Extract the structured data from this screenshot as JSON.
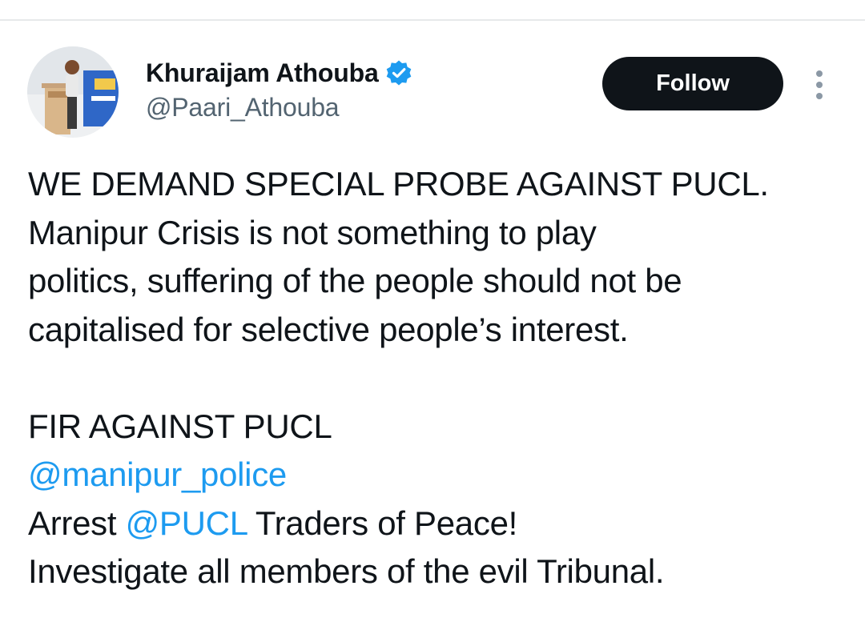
{
  "author": {
    "display_name": "Khuraijam Athouba",
    "handle": "@Paari_Athouba",
    "verified": true,
    "avatar_icon": "profile-photo"
  },
  "actions": {
    "follow_label": "Follow",
    "more_icon": "more-vertical-icon"
  },
  "tweet": {
    "line1": "WE DEMAND SPECIAL PROBE AGAINST PUCL.",
    "line2": "Manipur Crisis is not something to play",
    "line3": "politics, suffering of the people should not be",
    "line4": "capitalised for selective people’s interest.",
    "line5": "FIR AGAINST PUCL",
    "mention1": "@manipur_police",
    "line7_prefix": "Arrest ",
    "mention2": "@PUCL",
    "line7_suffix": " Traders of Peace!",
    "line8": "Investigate all members of the evil Tribunal."
  },
  "colors": {
    "text": "#0f1419",
    "secondary": "#536471",
    "link": "#1d9bf0",
    "button_bg": "#0f1419",
    "button_text": "#ffffff"
  }
}
